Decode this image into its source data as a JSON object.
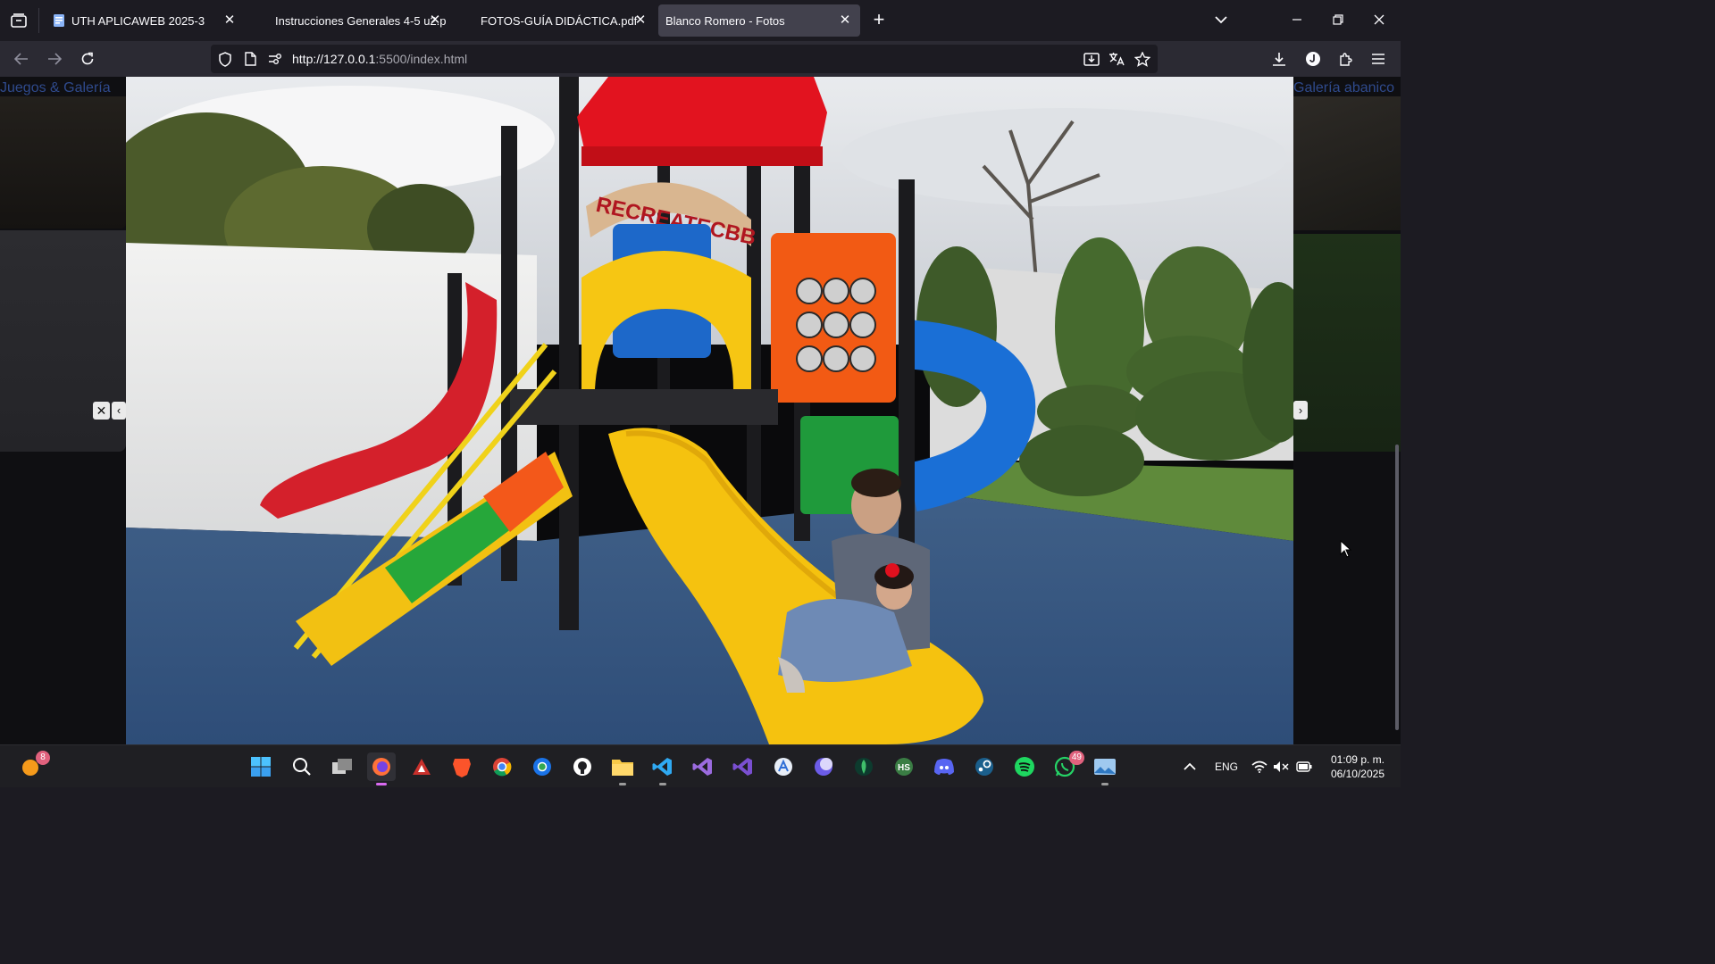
{
  "browser": {
    "tabs": [
      {
        "title": "UTH APLICAWEB 2025-3",
        "active": false,
        "favicon": "document-favicon-icon"
      },
      {
        "title": "Instrucciones Generales 4-5 u2.p",
        "active": false,
        "favicon": "none"
      },
      {
        "title": "FOTOS-GUÍA DIDÁCTICA.pdf",
        "active": false,
        "favicon": "none"
      },
      {
        "title": "Blanco Romero - Fotos",
        "active": true,
        "favicon": "none"
      }
    ],
    "close_glyph": "✕",
    "new_tab_glyph": "+",
    "url_host": "http://127.0.0.1",
    "url_rest": ":5500/index.html"
  },
  "page": {
    "left_section_title": "Juegos & Galería",
    "right_section_title": "Galería abanico",
    "lightbox": {
      "close_label": "✕",
      "prev_label": "‹",
      "next_label": "›",
      "sign_text": "RECREATECBB"
    }
  },
  "taskbar": {
    "notification_badge": "8",
    "whatsapp_badge": "49",
    "language": "ENG",
    "time": "01:09 p. m.",
    "date": "06/10/2025"
  },
  "colors": {
    "tab_active": "#42414d",
    "toolbar": "#2b2a33",
    "accent_link": "#2f4a8c"
  }
}
